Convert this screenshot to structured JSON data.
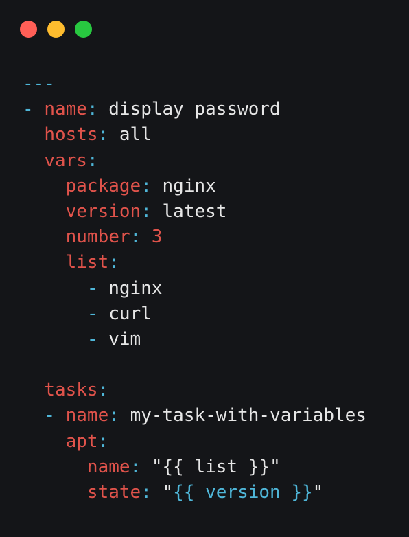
{
  "window": {
    "controls": {
      "close_color": "#ff5f57",
      "minimize_color": "#febc2e",
      "maximize_color": "#28c840"
    }
  },
  "colors": {
    "background": "#141518",
    "key": "#e0534b",
    "punctuation": "#4fb6d8",
    "value": "#e6e6e6"
  },
  "code": {
    "doc_start": "---",
    "dash": "-",
    "colon": ":",
    "quote": "\"",
    "play_name_key": "name",
    "play_name_value": "display password",
    "hosts_key": "hosts",
    "hosts_value": "all",
    "vars_key": "vars",
    "package_key": "package",
    "package_value": "nginx",
    "version_key": "version",
    "version_value": "latest",
    "number_key": "number",
    "number_value": "3",
    "list_key": "list",
    "list_items": [
      "nginx",
      "curl",
      "vim"
    ],
    "tasks_key": "tasks",
    "task_name_key": "name",
    "task_name_value": "my-task-with-variables",
    "apt_key": "apt",
    "apt_name_key": "name",
    "apt_name_value": "{{ list }}",
    "apt_state_key": "state",
    "apt_state_value": "{{ version }}"
  }
}
